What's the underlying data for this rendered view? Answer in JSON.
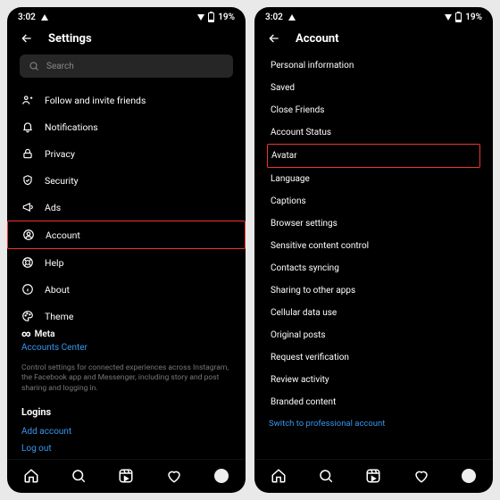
{
  "status": {
    "time": "3:02",
    "battery": "19%"
  },
  "left": {
    "title": "Settings",
    "search_placeholder": "Search",
    "items": [
      {
        "icon": "person-plus-icon",
        "label": "Follow and invite friends"
      },
      {
        "icon": "bell-icon",
        "label": "Notifications"
      },
      {
        "icon": "lock-icon",
        "label": "Privacy"
      },
      {
        "icon": "shield-icon",
        "label": "Security"
      },
      {
        "icon": "megaphone-icon",
        "label": "Ads"
      },
      {
        "icon": "user-circle-icon",
        "label": "Account",
        "highlight": true
      },
      {
        "icon": "lifebuoy-icon",
        "label": "Help"
      },
      {
        "icon": "info-icon",
        "label": "About"
      },
      {
        "icon": "palette-icon",
        "label": "Theme"
      }
    ],
    "meta_brand": "Meta",
    "accounts_center": "Accounts Center",
    "accounts_desc": "Control settings for connected experiences across Instagram, the Facebook app and Messenger, including story and post sharing and logging in.",
    "logins_header": "Logins",
    "add_account": "Add account",
    "log_out": "Log out"
  },
  "right": {
    "title": "Account",
    "items": [
      "Personal information",
      "Saved",
      "Close Friends",
      "Account Status",
      "Avatar",
      "Language",
      "Captions",
      "Browser settings",
      "Sensitive content control",
      "Contacts syncing",
      "Sharing to other apps",
      "Cellular data use",
      "Original posts",
      "Request verification",
      "Review activity",
      "Branded content"
    ],
    "highlight_index": 4,
    "switch_pro": "Switch to professional account"
  }
}
